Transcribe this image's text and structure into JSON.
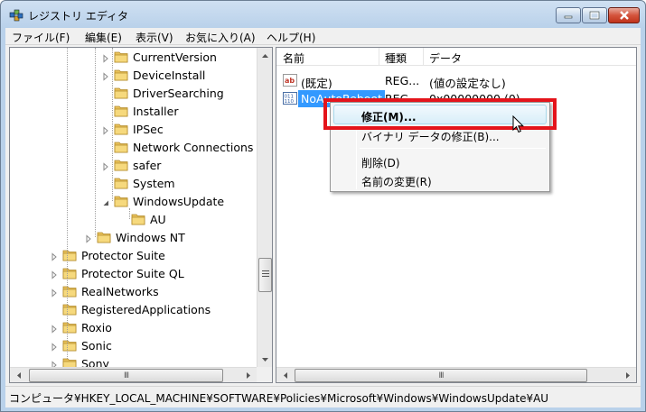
{
  "window": {
    "title": "レジストリ エディタ",
    "menu": [
      "ファイル(F)",
      "編集(E)",
      "表示(V)",
      "お気に入り(A)",
      "ヘルプ(H)"
    ]
  },
  "tree": {
    "items": [
      {
        "label": "CurrentVersion",
        "expander": "collapsed"
      },
      {
        "label": "DeviceInstall",
        "expander": "collapsed"
      },
      {
        "label": "DriverSearching",
        "expander": "none"
      },
      {
        "label": "Installer",
        "expander": "none"
      },
      {
        "label": "IPSec",
        "expander": "collapsed"
      },
      {
        "label": "Network Connections",
        "expander": "none"
      },
      {
        "label": "safer",
        "expander": "collapsed"
      },
      {
        "label": "System",
        "expander": "none"
      },
      {
        "label": "WindowsUpdate",
        "expander": "expanded"
      },
      {
        "label": "AU",
        "expander": "none"
      },
      {
        "label": "Windows NT",
        "expander": "collapsed"
      },
      {
        "label": "Protector Suite",
        "expander": "collapsed"
      },
      {
        "label": "Protector Suite QL",
        "expander": "collapsed"
      },
      {
        "label": "RealNetworks",
        "expander": "collapsed"
      },
      {
        "label": "RegisteredApplications",
        "expander": "none"
      },
      {
        "label": "Roxio",
        "expander": "collapsed"
      },
      {
        "label": "Sonic",
        "expander": "collapsed"
      },
      {
        "label": "Sony",
        "expander": "collapsed"
      }
    ],
    "hscroll_grip": "III"
  },
  "list": {
    "columns": [
      "名前",
      "種類",
      "データ"
    ],
    "rows": [
      {
        "name": "(既定)",
        "type": "REG...",
        "data": "(値の設定なし)",
        "icon": "string-value-icon"
      },
      {
        "name": "NoAutoReboot",
        "type": "REG...",
        "data": "0x00000000 (0)",
        "icon": "dword-value-icon"
      }
    ],
    "hscroll_grip": "III"
  },
  "context_menu": {
    "items": [
      "修正(M)...",
      "バイナリ データの修正(B)...",
      "削除(D)",
      "名前の変更(R)"
    ]
  },
  "status": {
    "path": "コンピュータ¥HKEY_LOCAL_MACHINE¥SOFTWARE¥Policies¥Microsoft¥Windows¥WindowsUpdate¥AU"
  },
  "colors": {
    "annotation_red": "#e4141b",
    "selection_blue": "#3399ff"
  }
}
